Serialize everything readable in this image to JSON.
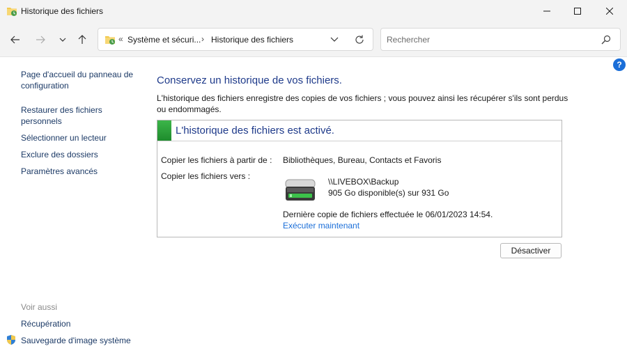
{
  "window": {
    "title": "Historique des fichiers",
    "icon": "file-history-folder-icon"
  },
  "address_bar": {
    "overflow": "«",
    "segments": [
      "Système et sécuri...",
      "Historique des fichiers"
    ],
    "separator": "›"
  },
  "search": {
    "placeholder": "Rechercher"
  },
  "sidebar": {
    "links": [
      "Page d'accueil du panneau de configuration",
      "Restaurer des fichiers personnels",
      "Sélectionner un lecteur",
      "Exclure des dossiers",
      "Paramètres avancés"
    ],
    "see_also_heading": "Voir aussi",
    "see_also": [
      "Récupération",
      "Sauvegarde d'image système"
    ]
  },
  "main": {
    "title": "Conservez un historique de vos fichiers.",
    "description": "L'historique des fichiers enregistre des copies de vos fichiers ; vous pouvez ainsi les récupérer s'ils sont perdus ou endommagés.",
    "status_title": "L'historique des fichiers est activé.",
    "copy_from_label": "Copier les fichiers à partir de :",
    "copy_from_value": "Bibliothèques, Bureau, Contacts et Favoris",
    "copy_to_label": "Copier les fichiers vers :",
    "drive_path": "\\\\LIVEBOX\\Backup",
    "drive_space": "905 Go disponible(s) sur 931 Go",
    "last_copy": "Dernière copie de fichiers effectuée le 06/01/2023 14:54.",
    "run_now": "Exécuter maintenant",
    "deactivate_button": "Désactiver"
  },
  "colors": {
    "accent_title": "#1e3a8a",
    "link": "#1a6ed8",
    "status_green": "#2ea33c"
  }
}
